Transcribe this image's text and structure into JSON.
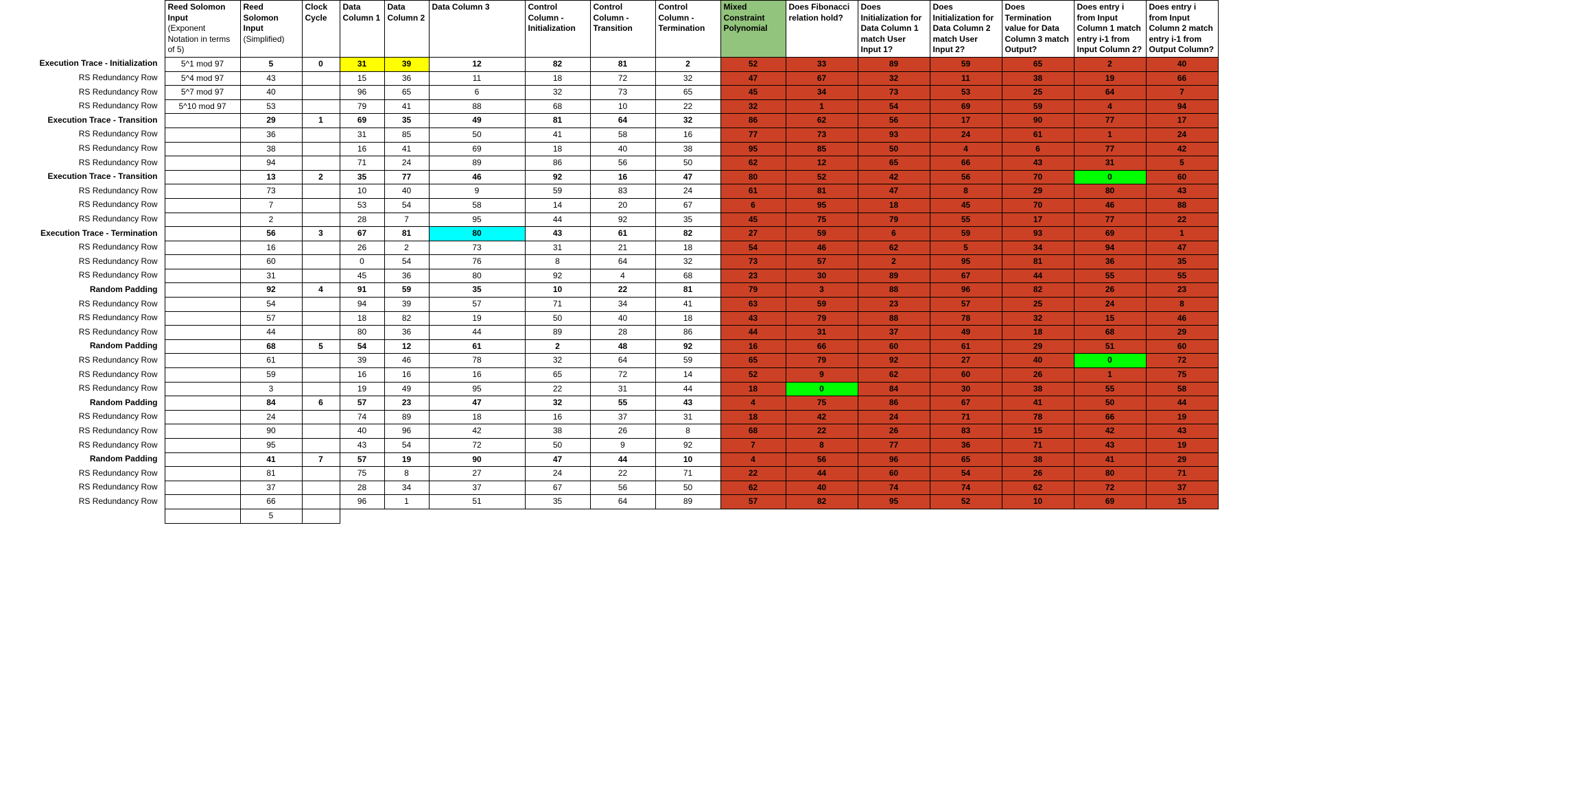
{
  "headers": [
    {
      "key": "label",
      "cls": "col-label",
      "html": ""
    },
    {
      "key": "rs1",
      "cls": "col-rs1",
      "html": "<b>Reed Solomon Input</b><br><span class='hdr-sub'>(Exponent Notation in terms of 5)</span>"
    },
    {
      "key": "rs2",
      "cls": "col-rs2",
      "html": "<b>Reed Solomon Input</b><br><span class='hdr-sub'>(Simplified)</span>"
    },
    {
      "key": "clk",
      "cls": "col-clk",
      "html": "<b>Clock Cycle</b>"
    },
    {
      "key": "dc1",
      "cls": "col-dc",
      "html": "<b>Data Column 1</b>"
    },
    {
      "key": "dc2",
      "cls": "col-dc",
      "html": "<b>Data Column 2</b>"
    },
    {
      "key": "dc3",
      "cls": "col-dc3",
      "html": "<b>Data Column 3</b>"
    },
    {
      "key": "cc1",
      "cls": "col-cc",
      "html": "<b>Control Column - Initialization</b>"
    },
    {
      "key": "cc2",
      "cls": "col-cc",
      "html": "<b>Control Column - Transition</b>"
    },
    {
      "key": "cc3",
      "cls": "col-cc",
      "html": "<b>Control Column - Termination</b>"
    },
    {
      "key": "mcp",
      "cls": "col-mcp",
      "html": "<b>Mixed Constraint Polynomial</b>"
    },
    {
      "key": "q1",
      "cls": "col-q",
      "html": "<b>Does Fibonacci relation hold?</b>"
    },
    {
      "key": "q2",
      "cls": "col-q",
      "html": "<b>Does Initialization for Data Column 1 match User Input 1?</b>"
    },
    {
      "key": "q3",
      "cls": "col-q",
      "html": "<b>Does Initialization for Data Column 2 match User Input 2?</b>"
    },
    {
      "key": "q4",
      "cls": "col-q",
      "html": "<b>Does Termination value for Data Column 3 match Output?</b>"
    },
    {
      "key": "q5",
      "cls": "col-q",
      "html": "<b>Does entry i from Input Column 1 match entry i-1 from Input Column 2?</b>"
    },
    {
      "key": "q6",
      "cls": "col-q",
      "html": "<b>Does entry i from Input Column 2 match entry i-1 from Output Column?</b>"
    }
  ],
  "rows": [
    {
      "label": "Execution Trace - Initialization",
      "bold": true,
      "rs1": "5^1 mod 97",
      "rs2": "5",
      "clk": "0",
      "dc1": "31",
      "dc1_hl": "yellow",
      "dc2": "39",
      "dc2_hl": "yellow",
      "dc3": "12",
      "cc1": "82",
      "cc2": "81",
      "cc3": "2",
      "mcp": "52",
      "q1": "33",
      "q2": "89",
      "q3": "59",
      "q4": "65",
      "q5": "2",
      "q6": "40"
    },
    {
      "label": "RS Redundancy Row",
      "rs1": "5^4 mod 97",
      "rs2": "43",
      "dc1": "15",
      "dc2": "36",
      "dc3": "11",
      "cc1": "18",
      "cc2": "72",
      "cc3": "32",
      "mcp": "47",
      "q1": "67",
      "q2": "32",
      "q3": "11",
      "q4": "38",
      "q5": "19",
      "q6": "66",
      "norm": true
    },
    {
      "label": "RS Redundancy Row",
      "rs1": "5^7 mod 97",
      "rs2": "40",
      "dc1": "96",
      "dc2": "65",
      "dc3": "6",
      "cc1": "32",
      "cc2": "73",
      "cc3": "65",
      "mcp": "45",
      "q1": "34",
      "q2": "73",
      "q3": "53",
      "q4": "25",
      "q5": "64",
      "q6": "7",
      "norm": true
    },
    {
      "label": "RS Redundancy Row",
      "rs1": "5^10 mod 97",
      "rs2": "53",
      "dc1": "79",
      "dc2": "41",
      "dc3": "88",
      "cc1": "68",
      "cc2": "10",
      "cc3": "22",
      "mcp": "32",
      "q1": "1",
      "q2": "54",
      "q3": "69",
      "q4": "59",
      "q5": "4",
      "q6": "94",
      "norm": true
    },
    {
      "label": "Execution Trace - Transition",
      "bold": true,
      "rs2": "29",
      "clk": "1",
      "dc1": "69",
      "dc2": "35",
      "dc3": "49",
      "cc1": "81",
      "cc2": "64",
      "cc3": "32",
      "mcp": "86",
      "q1": "62",
      "q2": "56",
      "q3": "17",
      "q4": "90",
      "q5": "77",
      "q6": "17"
    },
    {
      "label": "RS Redundancy Row",
      "rs2": "36",
      "dc1": "31",
      "dc2": "85",
      "dc3": "50",
      "cc1": "41",
      "cc2": "58",
      "cc3": "16",
      "mcp": "77",
      "q1": "73",
      "q2": "93",
      "q3": "24",
      "q4": "61",
      "q5": "1",
      "q6": "24",
      "norm": true
    },
    {
      "label": "RS Redundancy Row",
      "rs2": "38",
      "dc1": "16",
      "dc2": "41",
      "dc3": "69",
      "cc1": "18",
      "cc2": "40",
      "cc3": "38",
      "mcp": "95",
      "q1": "85",
      "q2": "50",
      "q3": "4",
      "q4": "6",
      "q5": "77",
      "q6": "42",
      "norm": true
    },
    {
      "label": "RS Redundancy Row",
      "rs2": "94",
      "dc1": "71",
      "dc2": "24",
      "dc3": "89",
      "cc1": "86",
      "cc2": "56",
      "cc3": "50",
      "mcp": "62",
      "q1": "12",
      "q2": "65",
      "q3": "66",
      "q4": "43",
      "q5": "31",
      "q6": "5",
      "norm": true
    },
    {
      "label": "Execution Trace - Transition",
      "bold": true,
      "rs2": "13",
      "clk": "2",
      "dc1": "35",
      "dc2": "77",
      "dc3": "46",
      "cc1": "92",
      "cc2": "16",
      "cc3": "47",
      "mcp": "80",
      "q1": "52",
      "q2": "42",
      "q3": "56",
      "q4": "70",
      "q5": "0",
      "q5_hl": "green",
      "q6": "60"
    },
    {
      "label": "RS Redundancy Row",
      "rs2": "73",
      "dc1": "10",
      "dc2": "40",
      "dc3": "9",
      "cc1": "59",
      "cc2": "83",
      "cc3": "24",
      "mcp": "61",
      "q1": "81",
      "q2": "47",
      "q3": "8",
      "q4": "29",
      "q5": "80",
      "q6": "43",
      "norm": true
    },
    {
      "label": "RS Redundancy Row",
      "rs2": "7",
      "dc1": "53",
      "dc2": "54",
      "dc3": "58",
      "cc1": "14",
      "cc2": "20",
      "cc3": "67",
      "mcp": "6",
      "q1": "95",
      "q2": "18",
      "q3": "45",
      "q4": "70",
      "q5": "46",
      "q6": "88",
      "norm": true
    },
    {
      "label": "RS Redundancy Row",
      "rs2": "2",
      "dc1": "28",
      "dc2": "7",
      "dc3": "95",
      "cc1": "44",
      "cc2": "92",
      "cc3": "35",
      "mcp": "45",
      "q1": "75",
      "q2": "79",
      "q3": "55",
      "q4": "17",
      "q5": "77",
      "q6": "22",
      "norm": true
    },
    {
      "label": "Execution Trace - Termination",
      "bold": true,
      "rs2": "56",
      "clk": "3",
      "dc1": "67",
      "dc2": "81",
      "dc3": "80",
      "dc3_hl": "cyan",
      "cc1": "43",
      "cc2": "61",
      "cc3": "82",
      "mcp": "27",
      "q1": "59",
      "q2": "6",
      "q3": "59",
      "q4": "93",
      "q5": "69",
      "q6": "1"
    },
    {
      "label": "RS Redundancy Row",
      "rs2": "16",
      "dc1": "26",
      "dc2": "2",
      "dc3": "73",
      "cc1": "31",
      "cc2": "21",
      "cc3": "18",
      "mcp": "54",
      "q1": "46",
      "q2": "62",
      "q3": "5",
      "q4": "34",
      "q5": "94",
      "q6": "47",
      "norm": true
    },
    {
      "label": "RS Redundancy Row",
      "rs2": "60",
      "dc1": "0",
      "dc2": "54",
      "dc3": "76",
      "cc1": "8",
      "cc2": "64",
      "cc3": "32",
      "mcp": "73",
      "q1": "57",
      "q2": "2",
      "q3": "95",
      "q4": "81",
      "q5": "36",
      "q6": "35",
      "norm": true
    },
    {
      "label": "RS Redundancy Row",
      "rs2": "31",
      "dc1": "45",
      "dc2": "36",
      "dc3": "80",
      "cc1": "92",
      "cc2": "4",
      "cc3": "68",
      "mcp": "23",
      "q1": "30",
      "q2": "89",
      "q3": "67",
      "q4": "44",
      "q5": "55",
      "q6": "55",
      "norm": true
    },
    {
      "label": "Random Padding",
      "bold": true,
      "rs2": "92",
      "clk": "4",
      "dc1": "91",
      "dc2": "59",
      "dc3": "35",
      "cc1": "10",
      "cc2": "22",
      "cc3": "81",
      "mcp": "79",
      "q1": "3",
      "q2": "88",
      "q3": "96",
      "q4": "82",
      "q5": "26",
      "q6": "23"
    },
    {
      "label": "RS Redundancy Row",
      "rs2": "54",
      "dc1": "94",
      "dc2": "39",
      "dc3": "57",
      "cc1": "71",
      "cc2": "34",
      "cc3": "41",
      "mcp": "63",
      "q1": "59",
      "q2": "23",
      "q3": "57",
      "q4": "25",
      "q5": "24",
      "q6": "8",
      "norm": true
    },
    {
      "label": "RS Redundancy Row",
      "rs2": "57",
      "dc1": "18",
      "dc2": "82",
      "dc3": "19",
      "cc1": "50",
      "cc2": "40",
      "cc3": "18",
      "mcp": "43",
      "q1": "79",
      "q2": "88",
      "q3": "78",
      "q4": "32",
      "q5": "15",
      "q6": "46",
      "norm": true
    },
    {
      "label": "RS Redundancy Row",
      "rs2": "44",
      "dc1": "80",
      "dc2": "36",
      "dc3": "44",
      "cc1": "89",
      "cc2": "28",
      "cc3": "86",
      "mcp": "44",
      "q1": "31",
      "q2": "37",
      "q3": "49",
      "q4": "18",
      "q5": "68",
      "q6": "29",
      "norm": true
    },
    {
      "label": "Random Padding",
      "bold": true,
      "rs2": "68",
      "clk": "5",
      "dc1": "54",
      "dc2": "12",
      "dc3": "61",
      "cc1": "2",
      "cc2": "48",
      "cc3": "92",
      "mcp": "16",
      "q1": "66",
      "q2": "60",
      "q3": "61",
      "q4": "29",
      "q5": "51",
      "q6": "60"
    },
    {
      "label": "RS Redundancy Row",
      "rs2": "61",
      "dc1": "39",
      "dc2": "46",
      "dc3": "78",
      "cc1": "32",
      "cc2": "64",
      "cc3": "59",
      "mcp": "65",
      "q1": "79",
      "q2": "92",
      "q3": "27",
      "q4": "40",
      "q5": "0",
      "q5_hl": "green",
      "q6": "72",
      "norm": true
    },
    {
      "label": "RS Redundancy Row",
      "rs2": "59",
      "dc1": "16",
      "dc2": "16",
      "dc3": "16",
      "cc1": "65",
      "cc2": "72",
      "cc3": "14",
      "mcp": "52",
      "q1": "9",
      "q2": "62",
      "q3": "60",
      "q4": "26",
      "q5": "1",
      "q6": "75",
      "norm": true
    },
    {
      "label": "RS Redundancy Row",
      "rs2": "3",
      "dc1": "19",
      "dc2": "49",
      "dc3": "95",
      "cc1": "22",
      "cc2": "31",
      "cc3": "44",
      "mcp": "18",
      "q1": "0",
      "q1_hl": "green",
      "q2": "84",
      "q3": "30",
      "q4": "38",
      "q5": "55",
      "q6": "58",
      "norm": true
    },
    {
      "label": "Random Padding",
      "bold": true,
      "rs2": "84",
      "clk": "6",
      "dc1": "57",
      "dc2": "23",
      "dc3": "47",
      "cc1": "32",
      "cc2": "55",
      "cc3": "43",
      "mcp": "4",
      "q1": "75",
      "q2": "86",
      "q3": "67",
      "q4": "41",
      "q5": "50",
      "q6": "44"
    },
    {
      "label": "RS Redundancy Row",
      "rs2": "24",
      "dc1": "74",
      "dc2": "89",
      "dc3": "18",
      "cc1": "16",
      "cc2": "37",
      "cc3": "31",
      "mcp": "18",
      "q1": "42",
      "q2": "24",
      "q3": "71",
      "q4": "78",
      "q5": "66",
      "q6": "19",
      "norm": true
    },
    {
      "label": "RS Redundancy Row",
      "rs2": "90",
      "dc1": "40",
      "dc2": "96",
      "dc3": "42",
      "cc1": "38",
      "cc2": "26",
      "cc3": "8",
      "mcp": "68",
      "q1": "22",
      "q2": "26",
      "q3": "83",
      "q4": "15",
      "q5": "42",
      "q6": "43",
      "norm": true
    },
    {
      "label": "RS Redundancy Row",
      "rs2": "95",
      "dc1": "43",
      "dc2": "54",
      "dc3": "72",
      "cc1": "50",
      "cc2": "9",
      "cc3": "92",
      "mcp": "7",
      "q1": "8",
      "q2": "77",
      "q3": "36",
      "q4": "71",
      "q5": "43",
      "q6": "19",
      "norm": true
    },
    {
      "label": "Random Padding",
      "bold": true,
      "rs2": "41",
      "clk": "7",
      "dc1": "57",
      "dc2": "19",
      "dc3": "90",
      "cc1": "47",
      "cc2": "44",
      "cc3": "10",
      "mcp": "4",
      "q1": "56",
      "q2": "96",
      "q3": "65",
      "q4": "38",
      "q5": "41",
      "q6": "29"
    },
    {
      "label": "RS Redundancy Row",
      "rs2": "81",
      "dc1": "75",
      "dc2": "8",
      "dc3": "27",
      "cc1": "24",
      "cc2": "22",
      "cc3": "71",
      "mcp": "22",
      "q1": "44",
      "q2": "60",
      "q3": "54",
      "q4": "26",
      "q5": "80",
      "q6": "71",
      "norm": true
    },
    {
      "label": "RS Redundancy Row",
      "rs2": "37",
      "dc1": "28",
      "dc2": "34",
      "dc3": "37",
      "cc1": "67",
      "cc2": "56",
      "cc3": "50",
      "mcp": "62",
      "q1": "40",
      "q2": "74",
      "q3": "74",
      "q4": "62",
      "q5": "72",
      "q6": "37",
      "norm": true
    },
    {
      "label": "RS Redundancy Row",
      "rs2": "66",
      "dc1": "96",
      "dc2": "1",
      "dc3": "51",
      "cc1": "35",
      "cc2": "64",
      "cc3": "89",
      "mcp": "57",
      "q1": "82",
      "q2": "95",
      "q3": "52",
      "q4": "10",
      "q5": "69",
      "q6": "15",
      "norm": true
    },
    {
      "label": "",
      "rs2": "5",
      "partial": true,
      "norm": true
    }
  ],
  "redCols": [
    "mcp",
    "q1",
    "q2",
    "q3",
    "q4",
    "q5",
    "q6"
  ],
  "dataCols": [
    "rs1",
    "rs2",
    "clk",
    "dc1",
    "dc2",
    "dc3",
    "cc1",
    "cc2",
    "cc3",
    "mcp",
    "q1",
    "q2",
    "q3",
    "q4",
    "q5",
    "q6"
  ]
}
